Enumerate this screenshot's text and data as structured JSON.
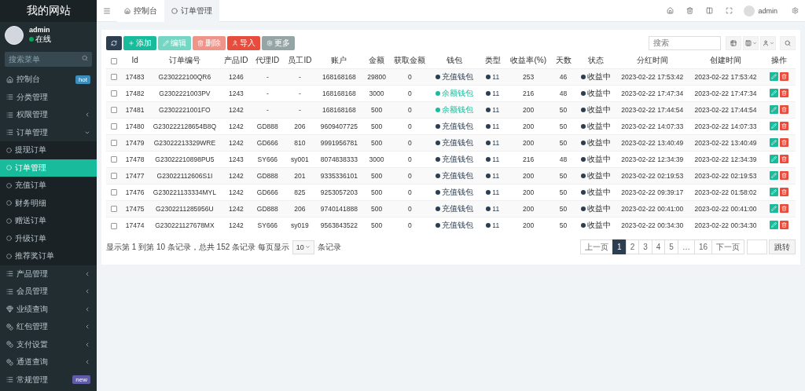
{
  "sidebar": {
    "title": "我的网站",
    "user": {
      "name": "admin",
      "status": "在线"
    },
    "search": {
      "placeholder": "搜索菜单"
    },
    "items": [
      {
        "label": "控制台",
        "selected": false,
        "badge": {
          "text": "hot",
          "color": "#3c8dbc"
        }
      },
      {
        "label": "分类管理",
        "selected": false
      },
      {
        "label": "权限管理",
        "selected": false,
        "expanded": false
      },
      {
        "label": "订单管理",
        "selected": false,
        "expanded": true,
        "children": [
          {
            "label": "提现订单",
            "selected": false
          },
          {
            "label": "订单管理",
            "selected": true
          },
          {
            "label": "充值订单",
            "selected": false
          },
          {
            "label": "财务明细",
            "selected": false
          },
          {
            "label": "赠送订单",
            "selected": false
          },
          {
            "label": "升级订单",
            "selected": false
          },
          {
            "label": "推荐奖订单",
            "selected": false
          }
        ]
      },
      {
        "label": "产品管理",
        "selected": false,
        "expanded": false
      },
      {
        "label": "会员管理",
        "selected": false,
        "expanded": false
      },
      {
        "label": "业绩查询",
        "selected": false,
        "expanded": false
      },
      {
        "label": "红包管理",
        "selected": false,
        "expanded": false
      },
      {
        "label": "支付设置",
        "selected": false,
        "expanded": false
      },
      {
        "label": "通道查询",
        "selected": false,
        "expanded": false
      },
      {
        "label": "常规管理",
        "selected": false,
        "badge": {
          "text": "new",
          "color": "#605ca8"
        }
      }
    ]
  },
  "topbar": {
    "tabs": [
      {
        "label": "控制台",
        "selected": false
      },
      {
        "label": "订单管理",
        "selected": true
      }
    ],
    "user": "admin"
  },
  "toolbar": {
    "buttons": [
      {
        "kind": "refresh",
        "disabled": false
      },
      {
        "kind": "add",
        "label": "添加",
        "disabled": false
      },
      {
        "kind": "edit",
        "label": "编辑",
        "disabled": true
      },
      {
        "kind": "delete",
        "label": "删除",
        "disabled": true
      },
      {
        "kind": "import",
        "label": "导入",
        "disabled": false
      },
      {
        "kind": "more",
        "label": "更多",
        "disabled": false
      }
    ],
    "search": {
      "placeholder": "搜索"
    }
  },
  "table": {
    "header_checked": false,
    "columns": [
      "Id",
      "订单编号",
      "产品ID",
      "代理ID",
      "员工ID",
      "账户",
      "金额",
      "获取金额",
      "钱包",
      "类型",
      "收益率(%)",
      "天数",
      "状态",
      "分红时间",
      "创建时间",
      "操作"
    ],
    "rows": [
      {
        "checked": false,
        "cells": [
          "17483",
          "G230222100QR6",
          "1246",
          "-",
          "-",
          "168168168",
          "29800",
          "0"
        ],
        "wallet": {
          "text": "充值钱包",
          "color": "#2c3e50"
        },
        "type": "11",
        "rate": "253",
        "days": "46",
        "status": "收益中",
        "dividend_time": "2023-02-22 17:53:42",
        "created": "2023-02-22 17:53:42"
      },
      {
        "checked": false,
        "cells": [
          "17482",
          "G2302221003PV",
          "1243",
          "-",
          "-",
          "168168168",
          "3000",
          "0"
        ],
        "wallet": {
          "text": "余额钱包",
          "color": "#18bc9c"
        },
        "type": "11",
        "rate": "216",
        "days": "48",
        "status": "收益中",
        "dividend_time": "2023-02-22 17:47:34",
        "created": "2023-02-22 17:47:34"
      },
      {
        "checked": false,
        "cells": [
          "17481",
          "G2302221001FO",
          "1242",
          "-",
          "-",
          "168168168",
          "500",
          "0"
        ],
        "wallet": {
          "text": "余额钱包",
          "color": "#18bc9c"
        },
        "type": "11",
        "rate": "200",
        "days": "50",
        "status": "收益中",
        "dividend_time": "2023-02-22 17:44:54",
        "created": "2023-02-22 17:44:54"
      },
      {
        "checked": false,
        "cells": [
          "17480",
          "G230222128654B8Q",
          "1242",
          "GD888",
          "206",
          "9609407725",
          "500",
          "0"
        ],
        "wallet": {
          "text": "充值钱包",
          "color": "#2c3e50"
        },
        "type": "11",
        "rate": "200",
        "days": "50",
        "status": "收益中",
        "dividend_time": "2023-02-22 14:07:33",
        "created": "2023-02-22 14:07:33"
      },
      {
        "checked": false,
        "cells": [
          "17479",
          "G23022213329WRE",
          "1242",
          "GD666",
          "810",
          "9991956781",
          "500",
          "0"
        ],
        "wallet": {
          "text": "充值钱包",
          "color": "#2c3e50"
        },
        "type": "11",
        "rate": "200",
        "days": "50",
        "status": "收益中",
        "dividend_time": "2023-02-22 13:40:49",
        "created": "2023-02-22 13:40:49"
      },
      {
        "checked": false,
        "cells": [
          "17478",
          "G23022210898PU5",
          "1243",
          "SY666",
          "sy001",
          "8074838333",
          "3000",
          "0"
        ],
        "wallet": {
          "text": "充值钱包",
          "color": "#2c3e50"
        },
        "type": "11",
        "rate": "216",
        "days": "48",
        "status": "收益中",
        "dividend_time": "2023-02-22 12:34:39",
        "created": "2023-02-22 12:34:39"
      },
      {
        "checked": false,
        "cells": [
          "17477",
          "G23022112606S1I",
          "1242",
          "GD888",
          "201",
          "9335336101",
          "500",
          "0"
        ],
        "wallet": {
          "text": "充值钱包",
          "color": "#2c3e50"
        },
        "type": "11",
        "rate": "200",
        "days": "50",
        "status": "收益中",
        "dividend_time": "2023-02-22 02:19:53",
        "created": "2023-02-22 02:19:53"
      },
      {
        "checked": false,
        "cells": [
          "17476",
          "G230221133334MYL",
          "1242",
          "GD666",
          "825",
          "9253057203",
          "500",
          "0"
        ],
        "wallet": {
          "text": "充值钱包",
          "color": "#2c3e50"
        },
        "type": "11",
        "rate": "200",
        "days": "50",
        "status": "收益中",
        "dividend_time": "2023-02-22 09:39:17",
        "created": "2023-02-22 01:58:02"
      },
      {
        "checked": false,
        "cells": [
          "17475",
          "G2302211285956U",
          "1242",
          "GD888",
          "206",
          "9740141888",
          "500",
          "0"
        ],
        "wallet": {
          "text": "充值钱包",
          "color": "#2c3e50"
        },
        "type": "11",
        "rate": "200",
        "days": "50",
        "status": "收益中",
        "dividend_time": "2023-02-22 00:41:00",
        "created": "2023-02-22 00:41:00"
      },
      {
        "checked": false,
        "cells": [
          "17474",
          "G230221127678MX",
          "1242",
          "SY666",
          "sy019",
          "9563843522",
          "500",
          "0"
        ],
        "wallet": {
          "text": "充值钱包",
          "color": "#2c3e50"
        },
        "type": "11",
        "rate": "200",
        "days": "50",
        "status": "收益中",
        "dividend_time": "2023-02-22 00:34:30",
        "created": "2023-02-22 00:34:30"
      }
    ]
  },
  "footer": {
    "summary": "显示第 1 到第 10 条记录，总共 152 条记录 每页显示",
    "page_size": "10",
    "page_size_suffix": "条记录",
    "pagination": {
      "prev": "上一页",
      "pages": [
        {
          "label": "1",
          "selected": true
        },
        {
          "label": "2",
          "selected": false
        },
        {
          "label": "3",
          "selected": false
        },
        {
          "label": "4",
          "selected": false
        },
        {
          "label": "5",
          "selected": false
        },
        {
          "label": "…",
          "selected": false
        },
        {
          "label": "16",
          "selected": false
        }
      ],
      "next": "下一页",
      "jump": "跳转"
    }
  }
}
